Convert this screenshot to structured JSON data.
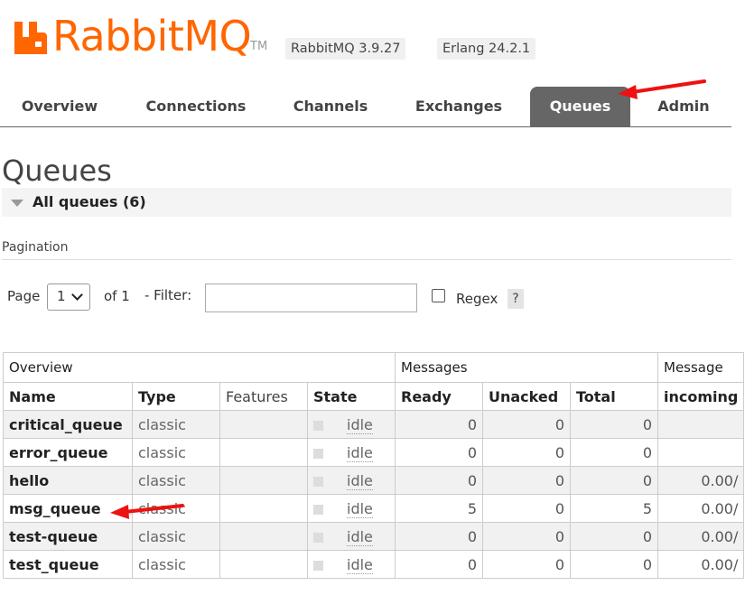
{
  "brand": {
    "name_rabbit": "Rabbit",
    "name_mq": "MQ",
    "tm": "TM",
    "color": "#ff6600"
  },
  "versions": {
    "rabbitmq": "RabbitMQ 3.9.27",
    "erlang": "Erlang 24.2.1"
  },
  "tabs": [
    {
      "label": "Overview",
      "active": false
    },
    {
      "label": "Connections",
      "active": false
    },
    {
      "label": "Channels",
      "active": false
    },
    {
      "label": "Exchanges",
      "active": false
    },
    {
      "label": "Queues",
      "active": true
    },
    {
      "label": "Admin",
      "active": false
    }
  ],
  "page": {
    "title": "Queues",
    "section": "All queues (6)",
    "pagination_label": "Pagination"
  },
  "pagination": {
    "page_label": "Page",
    "page_value": "1",
    "of_label": "of 1",
    "filter_label": "- Filter:",
    "filter_value": "",
    "regex_label": "Regex",
    "help_label": "?"
  },
  "table": {
    "groups": {
      "overview": "Overview",
      "messages": "Messages",
      "message_rates": "Message"
    },
    "headers": {
      "name": "Name",
      "type": "Type",
      "features": "Features",
      "state": "State",
      "ready": "Ready",
      "unacked": "Unacked",
      "total": "Total",
      "incoming": "incoming"
    },
    "rows": [
      {
        "name": "critical_queue",
        "type": "classic",
        "features": "",
        "state": "idle",
        "ready": "0",
        "unacked": "0",
        "total": "0",
        "incoming": ""
      },
      {
        "name": "error_queue",
        "type": "classic",
        "features": "",
        "state": "idle",
        "ready": "0",
        "unacked": "0",
        "total": "0",
        "incoming": ""
      },
      {
        "name": "hello",
        "type": "classic",
        "features": "",
        "state": "idle",
        "ready": "0",
        "unacked": "0",
        "total": "0",
        "incoming": "0.00/"
      },
      {
        "name": "msg_queue",
        "type": "classic",
        "features": "",
        "state": "idle",
        "ready": "5",
        "unacked": "0",
        "total": "5",
        "incoming": "0.00/"
      },
      {
        "name": "test-queue",
        "type": "classic",
        "features": "",
        "state": "idle",
        "ready": "0",
        "unacked": "0",
        "total": "0",
        "incoming": "0.00/"
      },
      {
        "name": "test_queue",
        "type": "classic",
        "features": "",
        "state": "idle",
        "ready": "0",
        "unacked": "0",
        "total": "0",
        "incoming": "0.00/"
      }
    ]
  },
  "annotation_color": "#ee1111"
}
